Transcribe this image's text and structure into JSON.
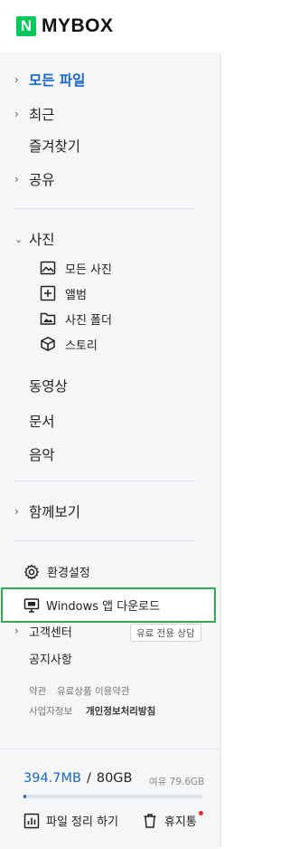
{
  "brand": {
    "logo_letter": "N",
    "name": "MYBOX"
  },
  "nav": {
    "all_files": "모든 파일",
    "recent": "최근",
    "favorites": "즐겨찾기",
    "shared": "공유",
    "photos": "사진",
    "photo_sub": {
      "all_photos": "모든 사진",
      "album": "앨범",
      "photo_folder": "사진 폴더",
      "story": "스토리"
    },
    "videos": "동영상",
    "documents": "문서",
    "music": "음악",
    "together": "함께보기"
  },
  "settings": {
    "env": "환경설정",
    "windows_download": "Windows 앱 다운로드"
  },
  "support": {
    "customer_center": "고객센터",
    "paid_consult": "유료 전용 상담",
    "notice": "공지사항",
    "terms": "약관",
    "paid_terms": "유료상품 이용약관",
    "business_info": "사업자정보",
    "privacy": "개인정보처리방침"
  },
  "storage": {
    "used": "394.7MB",
    "separator": "/",
    "total": "80GB",
    "free": "여유 79.6GB",
    "used_fraction": 0.005
  },
  "actions": {
    "organize": "파일 정리 하기",
    "trash": "휴지통"
  },
  "colors": {
    "accent": "#1a66c7",
    "brand": "#03c75a",
    "highlight_border": "#34a853",
    "notify": "#e03131"
  }
}
